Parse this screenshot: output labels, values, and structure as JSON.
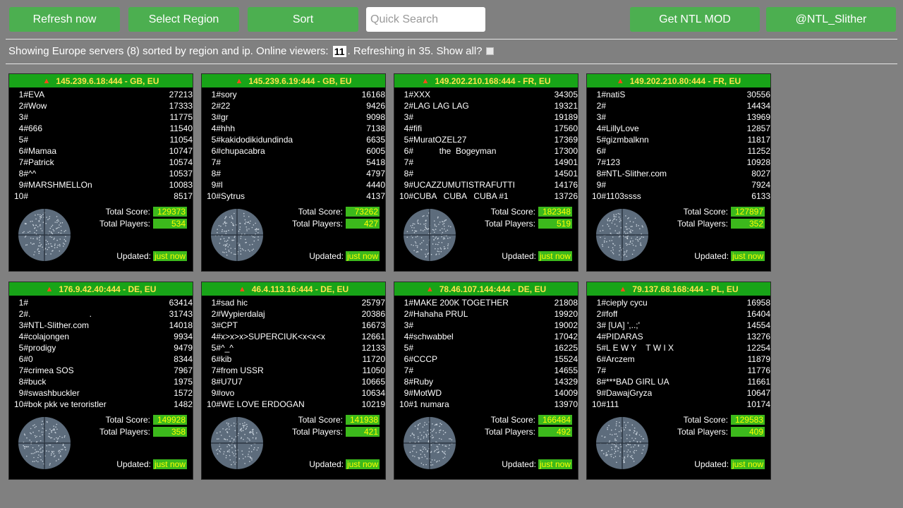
{
  "toolbar": {
    "refresh_label": "Refresh now",
    "region_label": "Select Region",
    "sort_label": "Sort",
    "search_placeholder": "Quick Search",
    "mod_label": "Get NTL MOD",
    "twitter_label": "@NTL_Slither"
  },
  "status": {
    "prefix": "Showing Europe servers (8) sorted by region and ip. Online viewers:",
    "viewers": "11",
    "suffix": ". Refreshing in 35. Show all?"
  },
  "labels": {
    "total_score": "Total Score:",
    "total_players": "Total Players:",
    "updated": "Updated:"
  },
  "colors": {
    "background": "#808080",
    "button": "#4caf50",
    "header_bar": "#18a418",
    "header_text": "#ffe44d",
    "value_bg": "#3cb91c",
    "value_text": "#ffff00"
  },
  "servers": [
    {
      "address": "145.239.6.18:444 - GB, EU",
      "players": [
        {
          "rank": "1#",
          "name": "EVA",
          "score": "27213"
        },
        {
          "rank": "2#",
          "name": "Wow",
          "score": "17333"
        },
        {
          "rank": "3#",
          "name": "",
          "score": "11775"
        },
        {
          "rank": "4#",
          "name": "666",
          "score": "11540"
        },
        {
          "rank": "5#",
          "name": "",
          "score": "11054"
        },
        {
          "rank": "6#",
          "name": "Mamaa",
          "score": "10747"
        },
        {
          "rank": "7#",
          "name": "Patrick",
          "score": "10574"
        },
        {
          "rank": "8#",
          "name": "^^",
          "score": "10537"
        },
        {
          "rank": "9#",
          "name": "MARSHMELLOn",
          "score": "10083"
        },
        {
          "rank": "10#",
          "name": "",
          "score": "8517"
        }
      ],
      "total_score": "129373",
      "total_players": "534",
      "updated": "just now"
    },
    {
      "address": "145.239.6.19:444 - GB, EU",
      "players": [
        {
          "rank": "1#",
          "name": "sory",
          "score": "16168"
        },
        {
          "rank": "2#",
          "name": "22",
          "score": "9426"
        },
        {
          "rank": "3#",
          "name": "gr",
          "score": "9098"
        },
        {
          "rank": "4#",
          "name": "hhh",
          "score": "7138"
        },
        {
          "rank": "5#",
          "name": "kakidodikidundinda",
          "score": "6635"
        },
        {
          "rank": "6#",
          "name": "chupacabra",
          "score": "6005"
        },
        {
          "rank": "7#",
          "name": "",
          "score": "5418"
        },
        {
          "rank": "8#",
          "name": "",
          "score": "4797"
        },
        {
          "rank": "9#",
          "name": "l",
          "score": "4440"
        },
        {
          "rank": "10#",
          "name": "Sytrus",
          "score": "4137"
        }
      ],
      "total_score": "73262",
      "total_players": "427",
      "updated": "just now"
    },
    {
      "address": "149.202.210.168:444 - FR, EU",
      "players": [
        {
          "rank": "1#",
          "name": "XXX",
          "score": "34305"
        },
        {
          "rank": "2#",
          "name": "LAG LAG LAG",
          "score": "19321"
        },
        {
          "rank": "3#",
          "name": "",
          "score": "19189"
        },
        {
          "rank": "4#",
          "name": "fifi",
          "score": "17560"
        },
        {
          "rank": "5#",
          "name": "MuratOZEL27",
          "score": "17369"
        },
        {
          "rank": "6#",
          "name": "           the  Bogeyman",
          "score": "17300"
        },
        {
          "rank": "7#",
          "name": "",
          "score": "14901"
        },
        {
          "rank": "8#",
          "name": "",
          "score": "14501"
        },
        {
          "rank": "9#",
          "name": "UCAZZUMUTISTRAFUTTI",
          "score": "14176"
        },
        {
          "rank": "10#",
          "name": "CUBA   CUBA   CUBA #1",
          "score": "13726"
        }
      ],
      "total_score": "182348",
      "total_players": "519",
      "updated": "just now"
    },
    {
      "address": "149.202.210.80:444 - FR, EU",
      "players": [
        {
          "rank": "1#",
          "name": "natiS",
          "score": "30556"
        },
        {
          "rank": "2#",
          "name": "",
          "score": "14434"
        },
        {
          "rank": "3#",
          "name": "",
          "score": "13969"
        },
        {
          "rank": "4#",
          "name": "LillyLove",
          "score": "12857"
        },
        {
          "rank": "5#",
          "name": "gizmbalknn",
          "score": "11817"
        },
        {
          "rank": "6#",
          "name": "",
          "score": "11252"
        },
        {
          "rank": "7#",
          "name": "123",
          "score": "10928"
        },
        {
          "rank": "8#",
          "name": "NTL-Slither.com",
          "score": "8027"
        },
        {
          "rank": "9#",
          "name": "",
          "score": "7924"
        },
        {
          "rank": "10#",
          "name": "1103ssss",
          "score": "6133"
        }
      ],
      "total_score": "127897",
      "total_players": "352",
      "updated": "just now"
    },
    {
      "address": "176.9.42.40:444 - DE, EU",
      "players": [
        {
          "rank": "1#",
          "name": "",
          "score": "63414"
        },
        {
          "rank": "2#",
          "name": ".                         .",
          "score": "31743"
        },
        {
          "rank": "3#",
          "name": "NTL-Slither.com",
          "score": "14018"
        },
        {
          "rank": "4#",
          "name": "colajongen",
          "score": "9934"
        },
        {
          "rank": "5#",
          "name": "prodigy",
          "score": "9479"
        },
        {
          "rank": "6#",
          "name": "0",
          "score": "8344"
        },
        {
          "rank": "7#",
          "name": "crimea SOS",
          "score": "7967"
        },
        {
          "rank": "8#",
          "name": "buck",
          "score": "1975"
        },
        {
          "rank": "9#",
          "name": "swashbuckler",
          "score": "1572"
        },
        {
          "rank": "10#",
          "name": "bok pkk ve teroristler",
          "score": "1482"
        }
      ],
      "total_score": "149928",
      "total_players": "358",
      "updated": "just now"
    },
    {
      "address": "46.4.113.16:444 - DE, EU",
      "players": [
        {
          "rank": "1#",
          "name": "sad hic",
          "score": "25797"
        },
        {
          "rank": "2#",
          "name": "Wypierdalaj",
          "score": "20386"
        },
        {
          "rank": "3#",
          "name": "CPT",
          "score": "16673"
        },
        {
          "rank": "4#",
          "name": "x>x>x>SUPERCIUK<x<x<x",
          "score": "12661"
        },
        {
          "rank": "5#",
          "name": "^_^",
          "score": "12133"
        },
        {
          "rank": "6#",
          "name": "kib",
          "score": "11720"
        },
        {
          "rank": "7#",
          "name": "from USSR",
          "score": "11050"
        },
        {
          "rank": "8#",
          "name": "U7U7",
          "score": "10665"
        },
        {
          "rank": "9#",
          "name": "ovo",
          "score": "10634"
        },
        {
          "rank": "10#",
          "name": "WE LOVE ERDOGAN",
          "score": "10219"
        }
      ],
      "total_score": "141938",
      "total_players": "421",
      "updated": "just now"
    },
    {
      "address": "78.46.107.144:444 - DE, EU",
      "players": [
        {
          "rank": "1#",
          "name": "MAKE 200K TOGETHER",
          "score": "21808"
        },
        {
          "rank": "2#",
          "name": "Hahaha PRUL",
          "score": "19920"
        },
        {
          "rank": "3#",
          "name": "",
          "score": "19002"
        },
        {
          "rank": "4#",
          "name": "schwabbel",
          "score": "17042"
        },
        {
          "rank": "5#",
          "name": "",
          "score": "16225"
        },
        {
          "rank": "6#",
          "name": "CCCP",
          "score": "15524"
        },
        {
          "rank": "7#",
          "name": "",
          "score": "14655"
        },
        {
          "rank": "8#",
          "name": "Ruby",
          "score": "14329"
        },
        {
          "rank": "9#",
          "name": "MotWD",
          "score": "14009"
        },
        {
          "rank": "10#",
          "name": "1 numara",
          "score": "13970"
        }
      ],
      "total_score": "166484",
      "total_players": "492",
      "updated": "just now"
    },
    {
      "address": "79.137.68.168:444 - PL, EU",
      "players": [
        {
          "rank": "1#",
          "name": "cieply cycu",
          "score": "16958"
        },
        {
          "rank": "2#",
          "name": "foff",
          "score": "16404"
        },
        {
          "rank": "3#",
          "name": " [UA] ',..;'",
          "score": "14554"
        },
        {
          "rank": "4#",
          "name": "PIDARAS",
          "score": "13276"
        },
        {
          "rank": "5#",
          "name": "L E W Y    T W I X",
          "score": "12254"
        },
        {
          "rank": "6#",
          "name": "Arczem",
          "score": "11879"
        },
        {
          "rank": "7#",
          "name": "",
          "score": "11776"
        },
        {
          "rank": "8#",
          "name": "***BAD GIRL UA",
          "score": "11661"
        },
        {
          "rank": "9#",
          "name": "DawajGryza",
          "score": "10647"
        },
        {
          "rank": "10#",
          "name": "111",
          "score": "10174"
        }
      ],
      "total_score": "129583",
      "total_players": "409",
      "updated": "just now"
    }
  ]
}
